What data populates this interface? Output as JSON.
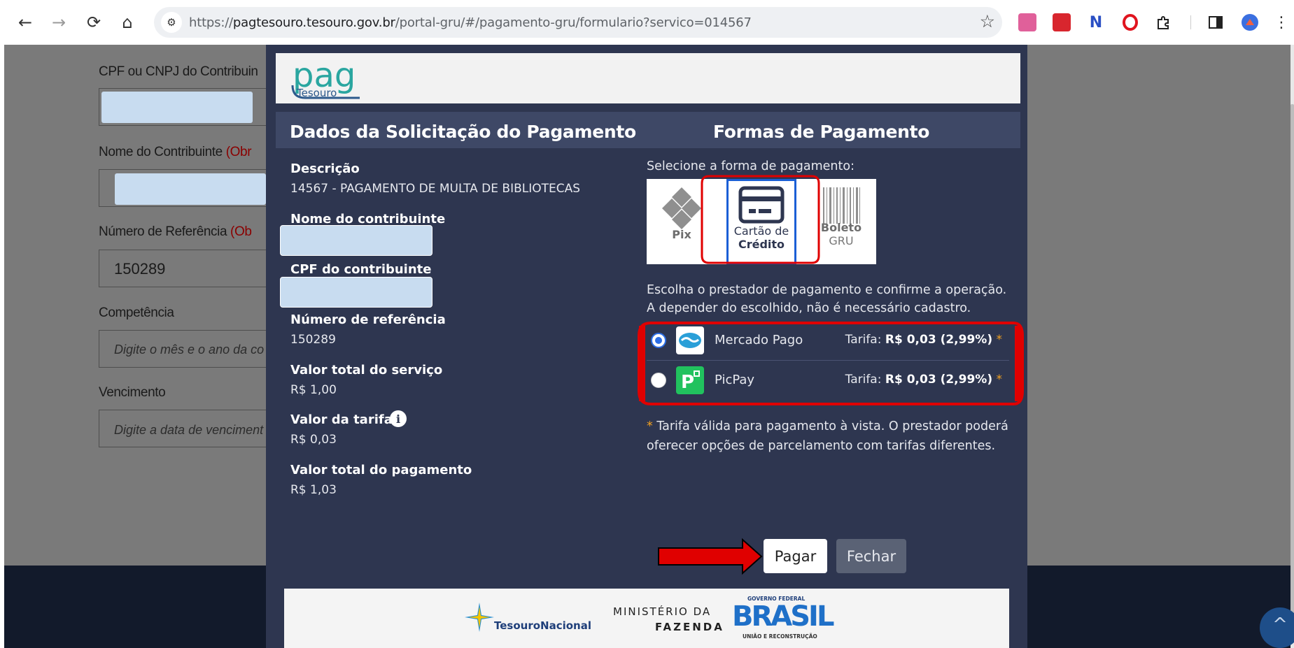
{
  "browser": {
    "url_prefix": "https://",
    "url_host": "pagtesouro.tesouro.gov.br",
    "url_path": "/portal-gru/#/pagamento-gru/formulario?servico=014567",
    "back_icon": "←",
    "forward_icon": "→",
    "reload_icon": "⟳",
    "home_icon": "⌂",
    "tune_icon": "⚙",
    "star_icon": "☆",
    "menu_icon": "⋮"
  },
  "background_form": {
    "label_cpf": "CPF ou CNPJ do Contribuin",
    "label_nome": "Nome do Contribuinte",
    "label_nome_req": "(Obr",
    "label_ref": "Número de Referência",
    "label_ref_req": "(Ob",
    "ref_value": "150289",
    "label_competencia": "Competência",
    "competencia_placeholder": "Digite o mês e o ano da co",
    "label_vencimento": "Vencimento",
    "vencimento_placeholder": "Digite a data de venciment",
    "scroll_top_icon": "^"
  },
  "modal": {
    "logo_text_top": "pag",
    "logo_text_bottom": "Tesouro",
    "left_title": "Dados da Solicitação do Pagamento",
    "right_title": "Formas de Pagamento",
    "descricao_label": "Descrição",
    "descricao_value": "14567 - PAGAMENTO DE MULTA DE BIBLIOTECAS",
    "nome_label": "Nome do contribuinte",
    "cpf_label": "CPF do contribuinte",
    "ref_label": "Número de referência",
    "ref_value": "150289",
    "valor_servico_label": "Valor total do serviço",
    "valor_servico_value": "R$  1,00",
    "valor_tarifa_label": "Valor da tarifa",
    "valor_tarifa_value": "R$  0,03",
    "valor_pagamento_label": "Valor total do pagamento",
    "valor_pagamento_value": "R$  1,03",
    "info_icon": "i",
    "select_prompt": "Selecione a forma de pagamento:",
    "tiles": {
      "pix_label": "Pix",
      "card_label_1": "Cartão de",
      "card_label_2": "Crédito",
      "boleto_label": "Boleto",
      "boleto_sub": "GRU"
    },
    "provider_prompt_1": "Escolha o prestador de pagamento e confirme a operação.",
    "provider_prompt_2": "A depender do escolhido, não é necessário cadastro.",
    "providers": [
      {
        "name": "Mercado Pago",
        "fee_label": "Tarifa:",
        "fee_value": "R$  0,03 (2,99%)",
        "asterisk": "*",
        "selected": true
      },
      {
        "name": "PicPay",
        "fee_label": "Tarifa:",
        "fee_value": "R$  0,03 (2,99%)",
        "asterisk": "*",
        "selected": false
      }
    ],
    "note_asterisk": "*",
    "note_line_1": " Tarifa válida para pagamento à vista. O prestador poderá",
    "note_line_2": "oferecer opções de parcelamento com tarifas diferentes.",
    "pagar_label": "Pagar",
    "fechar_label": "Fechar",
    "footer": {
      "tesouro_part_1": "Tesouro",
      "tesouro_part_2": "Nacional",
      "ministerio_1": "MINISTÉRIO DA",
      "ministerio_2": "FAZENDA",
      "gov_top": "GOVERNO FEDERAL",
      "gov_word": "BRASIL",
      "gov_bottom": "UNIÃO E RECONSTRUÇÃO"
    }
  },
  "colors": {
    "modal_bg": "#2e3650",
    "section_bar": "#3e4866",
    "annotation_red": "#e00000",
    "selected_blue": "#2c6ee6"
  }
}
